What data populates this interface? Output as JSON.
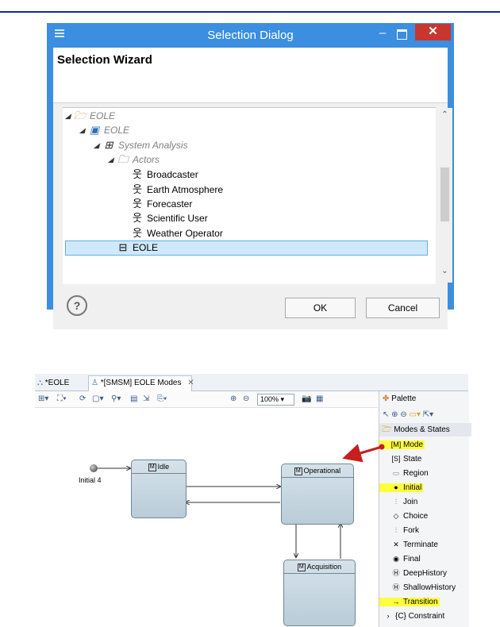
{
  "dialog": {
    "title": "Selection Dialog",
    "minimize": "–",
    "close": "✕",
    "wizard_title": "Selection Wizard",
    "tree": [
      {
        "label": "EOLE",
        "style": "grey"
      },
      {
        "label": "EOLE",
        "style": "grey"
      },
      {
        "label": "System Analysis",
        "style": "grey"
      },
      {
        "label": "Actors",
        "style": "grey"
      },
      {
        "label": "Broadcaster",
        "style": "normal"
      },
      {
        "label": "Earth Atmosphere",
        "style": "normal"
      },
      {
        "label": "Forecaster",
        "style": "normal"
      },
      {
        "label": "Scientific User",
        "style": "normal"
      },
      {
        "label": "Weather Operator",
        "style": "normal"
      },
      {
        "label": "EOLE",
        "style": "selected"
      }
    ],
    "help": "?",
    "ok_label": "OK",
    "cancel_label": "Cancel"
  },
  "editor": {
    "tabs": [
      {
        "label": "*EOLE"
      },
      {
        "label": "*[SMSM] EOLE Modes",
        "close": "✕"
      }
    ],
    "zoom": "100%",
    "states": [
      {
        "name": "Idle",
        "marker": "M"
      },
      {
        "name": "Operational",
        "marker": "M"
      },
      {
        "name": "Acquisition",
        "marker": "M"
      }
    ],
    "initial_label": "Initial 4",
    "palette": {
      "title": "Palette",
      "drawer": "Modes & States",
      "items": [
        {
          "label": "Mode",
          "icon": "mode-icon",
          "highlight": true
        },
        {
          "label": "State",
          "icon": "state-icon",
          "highlight": false
        },
        {
          "label": "Region",
          "icon": "region-icon",
          "highlight": false
        },
        {
          "label": "Initial",
          "icon": "initial-icon",
          "highlight": true
        },
        {
          "label": "Join",
          "icon": "join-icon",
          "highlight": false
        },
        {
          "label": "Choice",
          "icon": "choice-icon",
          "highlight": false
        },
        {
          "label": "Fork",
          "icon": "fork-icon",
          "highlight": false
        },
        {
          "label": "Terminate",
          "icon": "terminate-icon",
          "highlight": false
        },
        {
          "label": "Final",
          "icon": "final-icon",
          "highlight": false
        },
        {
          "label": "DeepHistory",
          "icon": "deep-history-icon",
          "highlight": false
        },
        {
          "label": "ShallowHistory",
          "icon": "shallow-history-icon",
          "highlight": false
        },
        {
          "label": "Transition",
          "icon": "transition-icon",
          "highlight": true
        },
        {
          "label": "{C} Constraint",
          "icon": "constraint-icon",
          "highlight": false
        }
      ]
    }
  },
  "colors": {
    "title_bar": "#3b8ee0",
    "close_button": "#c7372f",
    "selection": "#cfe8fb",
    "highlight": "#ffff3c",
    "annotation_arrow": "#c81e1e"
  }
}
